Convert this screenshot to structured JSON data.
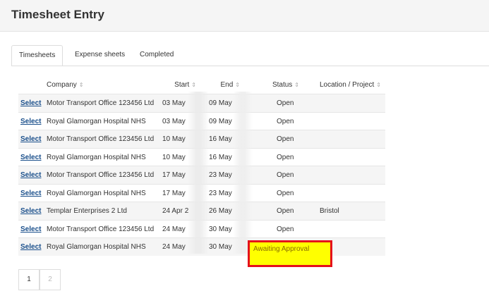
{
  "header": {
    "title": "Timesheet Entry"
  },
  "tabs": [
    {
      "label": "Timesheets",
      "active": true
    },
    {
      "label": "Expense sheets",
      "active": false
    },
    {
      "label": "Completed",
      "active": false
    }
  ],
  "table": {
    "columns": [
      "Company",
      "Start",
      "End",
      "Status",
      "Location / Project"
    ],
    "sort_glyph": "⇕",
    "select_label": "Select",
    "rows": [
      {
        "company": "Motor Transport Office 123456 Ltd",
        "start": "03 May",
        "end": "09 May",
        "status": "Open",
        "location": ""
      },
      {
        "company": "Royal Glamorgan Hospital NHS",
        "start": "03 May",
        "end": "09 May",
        "status": "Open",
        "location": ""
      },
      {
        "company": "Motor Transport Office 123456 Ltd",
        "start": "10 May",
        "end": "16 May",
        "status": "Open",
        "location": ""
      },
      {
        "company": "Royal Glamorgan Hospital NHS",
        "start": "10 May",
        "end": "16 May",
        "status": "Open",
        "location": ""
      },
      {
        "company": "Motor Transport Office 123456 Ltd",
        "start": "17 May",
        "end": "23 May",
        "status": "Open",
        "location": ""
      },
      {
        "company": "Royal Glamorgan Hospital NHS",
        "start": "17 May",
        "end": "23 May",
        "status": "Open",
        "location": ""
      },
      {
        "company": "Templar Enterprises 2 Ltd",
        "start": "24 Apr 2",
        "end": "26 May",
        "status": "Open",
        "location": "Bristol"
      },
      {
        "company": "Motor Transport Office 123456 Ltd",
        "start": "24 May",
        "end": "30 May",
        "status": "Open",
        "location": ""
      },
      {
        "company": "Royal Glamorgan Hospital NHS",
        "start": "24 May",
        "end": "30 May",
        "status": "Awaiting Approval",
        "location": ""
      }
    ]
  },
  "highlight": {
    "color": "#ffff00",
    "border_color": "#e5101b"
  },
  "pagination": {
    "pages": [
      "1",
      "2"
    ],
    "current": "1"
  }
}
